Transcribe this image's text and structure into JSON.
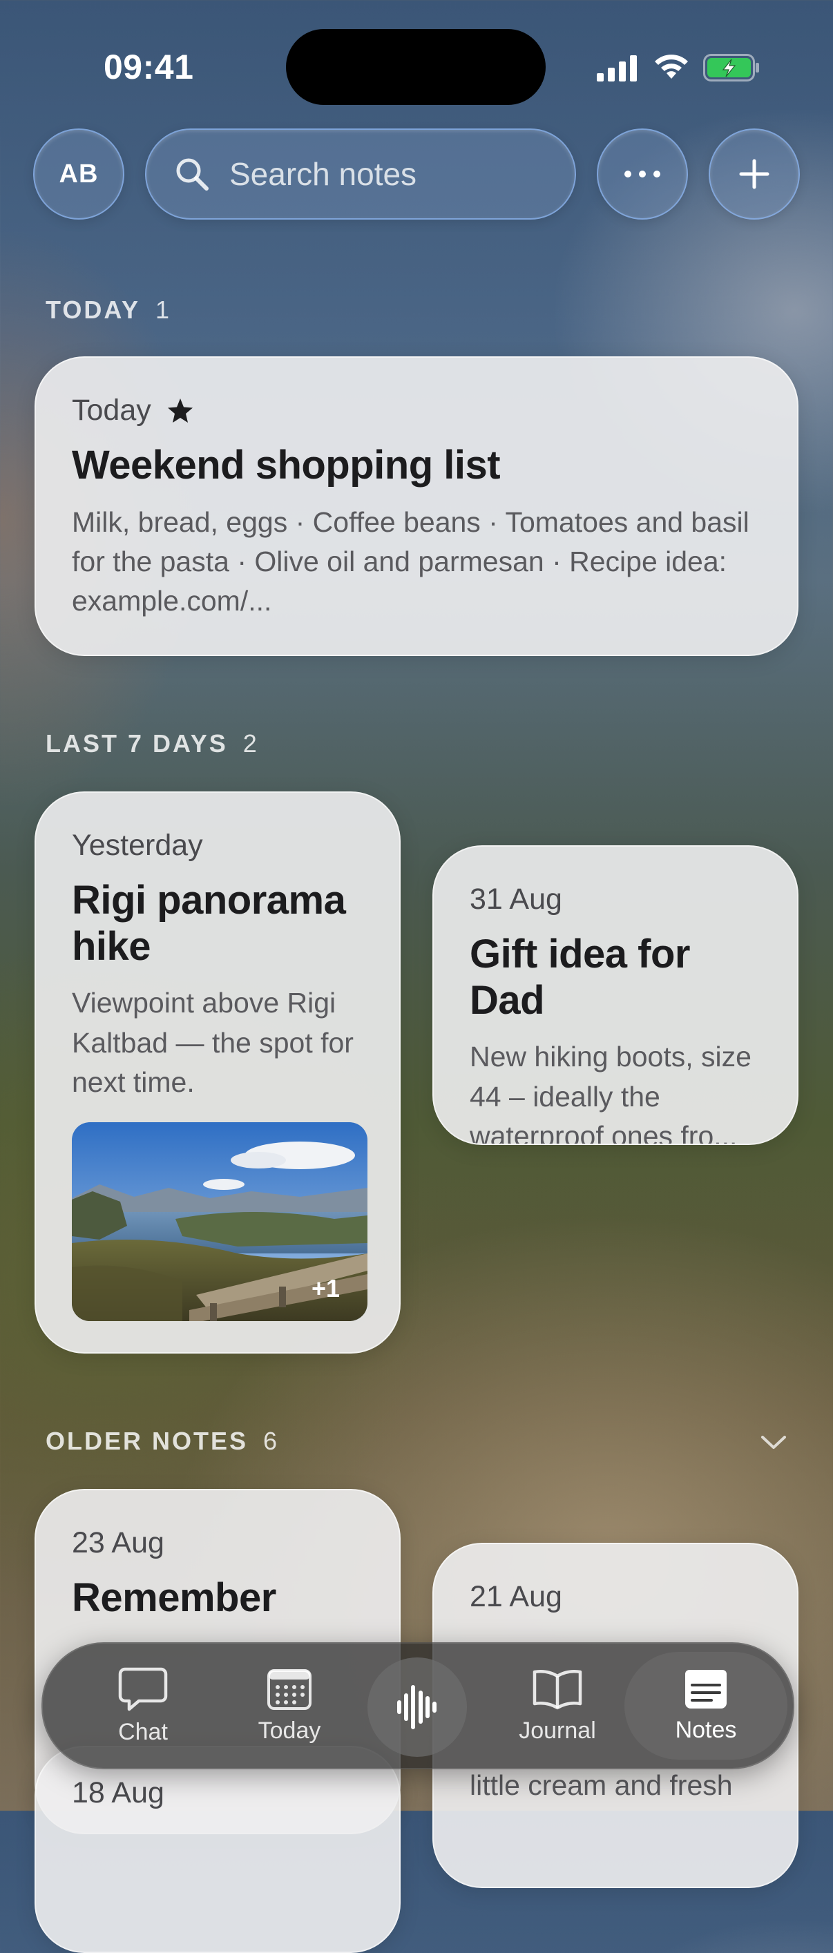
{
  "status": {
    "time": "09:41"
  },
  "header": {
    "avatar_initials": "AB",
    "search_placeholder": "Search notes"
  },
  "sections": {
    "today": {
      "label": "TODAY",
      "count": "1"
    },
    "last7": {
      "label": "LAST 7 DAYS",
      "count": "2"
    },
    "older": {
      "label": "OLDER NOTES",
      "count": "6"
    }
  },
  "notes": {
    "shopping": {
      "date": "Today",
      "starred": true,
      "title": "Weekend shopping list",
      "body": "Milk, bread, eggs · Coffee beans · Tomatoes and basil for the pasta · Olive oil and parmesan · Recipe idea: example.com/..."
    },
    "rigi": {
      "date": "Yesterday",
      "title": "Rigi panorama hike",
      "body": "Viewpoint above Rigi Kaltbad — the spot for next time.",
      "photo_extra": "+1"
    },
    "gift": {
      "date": "31 Aug",
      "title": "Gift idea for Dad",
      "body": "New hiking boots, size 44 – ideally the waterproof ones fro..."
    },
    "remember": {
      "date": "23 Aug",
      "title": "Remember"
    },
    "aug21": {
      "date": "21 Aug"
    },
    "aug18": {
      "date": "18 Aug"
    },
    "partial_body": "little cream and fresh"
  },
  "tabbar": {
    "chat": "Chat",
    "today": "Today",
    "journal": "Journal",
    "notes": "Notes",
    "active": "notes"
  }
}
